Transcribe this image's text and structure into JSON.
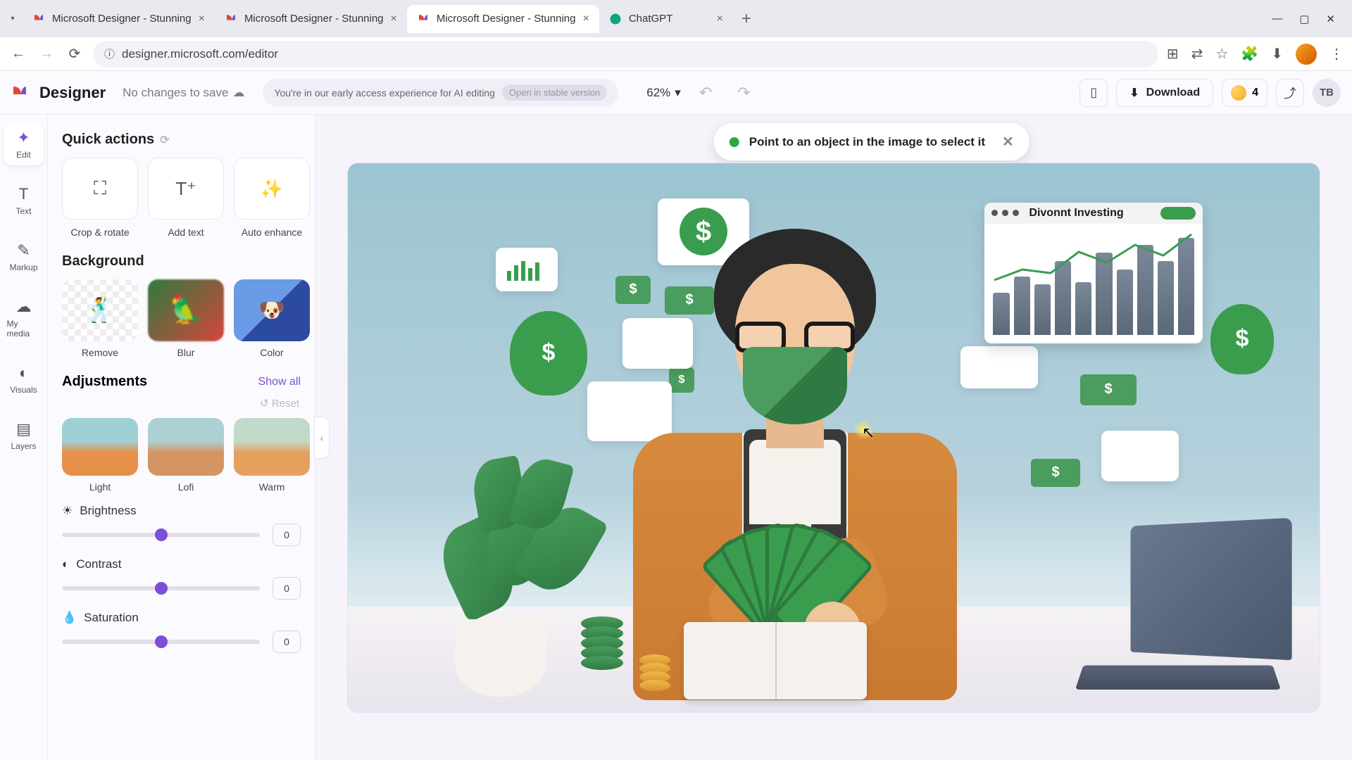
{
  "browser": {
    "tabs": [
      {
        "title": "Microsoft Designer - Stunning"
      },
      {
        "title": "Microsoft Designer - Stunning"
      },
      {
        "title": "Microsoft Designer - Stunning",
        "active": true
      },
      {
        "title": "ChatGPT"
      }
    ],
    "url": "designer.microsoft.com/editor"
  },
  "app": {
    "name": "Designer",
    "save_state": "No changes to save",
    "early_access_msg": "You're in our early access experience for AI editing",
    "stable_btn": "Open in stable version",
    "zoom": "62%",
    "download_label": "Download",
    "credits": "4",
    "user_initials": "TB"
  },
  "rail": {
    "edit": "Edit",
    "text": "Text",
    "markup": "Markup",
    "my_media": "My media",
    "visuals": "Visuals",
    "layers": "Layers"
  },
  "panel": {
    "quick_actions_title": "Quick actions",
    "crop": "Crop & rotate",
    "add_text": "Add text",
    "auto_enhance": "Auto enhance",
    "background_title": "Background",
    "bg_remove": "Remove",
    "bg_blur": "Blur",
    "bg_color": "Color",
    "adjustments_title": "Adjustments",
    "show_all": "Show all",
    "reset": "Reset",
    "filter_light": "Light",
    "filter_lofi": "Lofi",
    "filter_warm": "Warm",
    "brightness_label": "Brightness",
    "brightness_value": "0",
    "contrast_label": "Contrast",
    "contrast_value": "0",
    "saturation_label": "Saturation",
    "saturation_value": "0"
  },
  "canvas": {
    "hint": "Point to an object in the image to select it",
    "inv_window_title": "Divonnt Investing"
  }
}
